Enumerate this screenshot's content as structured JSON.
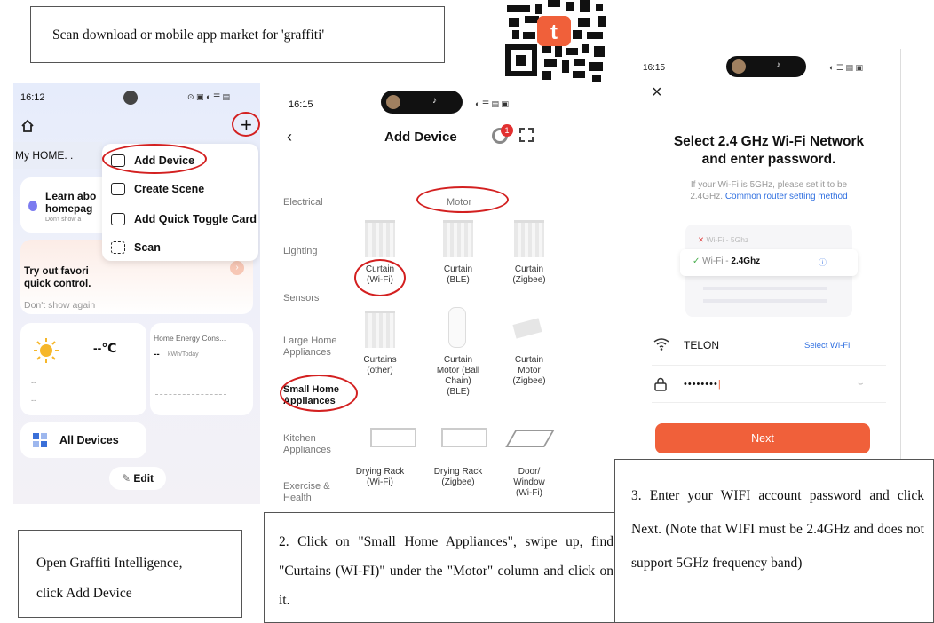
{
  "captions": {
    "top": "Scan download or mobile app market for 'graffiti'",
    "step1_line1": "Open Graffiti Intelligence,",
    "step1_line2": "click Add Device",
    "step2": "2. Click on \"Small Home Appliances\", swipe up, find \"Curtains (WI-FI)\" under the \"Motor\" column and click on it.",
    "step3": "3. Enter your WIFI account password and click Next. (Note that WIFI must be 2.4GHz and does not support 5GHz frequency band)"
  },
  "phone1": {
    "time": "16:12",
    "status_icons": "⊙ ▣ ◐ ☰ ▤",
    "home_label": "My HOME. .",
    "learn_title": "Learn abo",
    "learn_title2": "homepag",
    "learn_sub": "Don't show a",
    "try_title": "Try out favori",
    "try_title2": "quick control.",
    "dont_show": "Don't show again",
    "temp": "--℃",
    "dash1": "--",
    "dash2": "--",
    "energy_title": "Home Energy Cons...",
    "energy_value": "--",
    "energy_unit": "kWh/Today",
    "all_devices": "All Devices",
    "edit": "Edit",
    "menu": {
      "add_device": "Add Device",
      "create_scene": "Create Scene",
      "add_quick_toggle": "Add Quick Toggle Card",
      "scan": "Scan"
    }
  },
  "phone2": {
    "time": "16:15",
    "title": "Add Device",
    "badge": "1",
    "column_header": "Motor",
    "categories": [
      "Electrical",
      "Lighting",
      "Sensors",
      "Large Home Appliances",
      "Small Home Appliances",
      "Kitchen Appliances",
      "Exercise & Health"
    ],
    "products": [
      {
        "l1": "Curtain",
        "l2": "(Wi-Fi)",
        "l3": "",
        "l4": ""
      },
      {
        "l1": "Curtain",
        "l2": "(BLE)",
        "l3": "",
        "l4": ""
      },
      {
        "l1": "Curtain",
        "l2": "(Zigbee)",
        "l3": "",
        "l4": ""
      },
      {
        "l1": "Curtains",
        "l2": "(other)",
        "l3": "",
        "l4": ""
      },
      {
        "l1": "Curtain",
        "l2": "Motor (Ball",
        "l3": "Chain)",
        "l4": "(BLE)"
      },
      {
        "l1": "Curtain",
        "l2": "Motor",
        "l3": "(Zigbee)",
        "l4": ""
      },
      {
        "l1": "Drying Rack",
        "l2": "(Wi-Fi)",
        "l3": "",
        "l4": ""
      },
      {
        "l1": "Drying Rack",
        "l2": "(Zigbee)",
        "l3": "",
        "l4": ""
      },
      {
        "l1": "Door/",
        "l2": "Window",
        "l3": "(Wi-Fi)",
        "l4": ""
      }
    ]
  },
  "phone3": {
    "time": "16:15",
    "heading1": "Select 2.4 GHz Wi-Fi Network",
    "heading2": "and enter password.",
    "note1": "If your Wi-Fi is 5GHz, please set it to be",
    "note2_prefix": "2.4GHz.",
    "note2_link": "Common router setting method",
    "wifi_5g": "Wi-Fi - 5Ghz",
    "wifi_24g_prefix": "Wi-Fi -",
    "wifi_24g": "2.4Ghz",
    "ssid": "TELON",
    "select_wifi": "Select Wi-Fi",
    "password": "••••••••",
    "next": "Next"
  },
  "colors": {
    "annotation_red": "#d32020",
    "accent_orange": "#f0603a",
    "link_blue": "#2f6fe0"
  }
}
